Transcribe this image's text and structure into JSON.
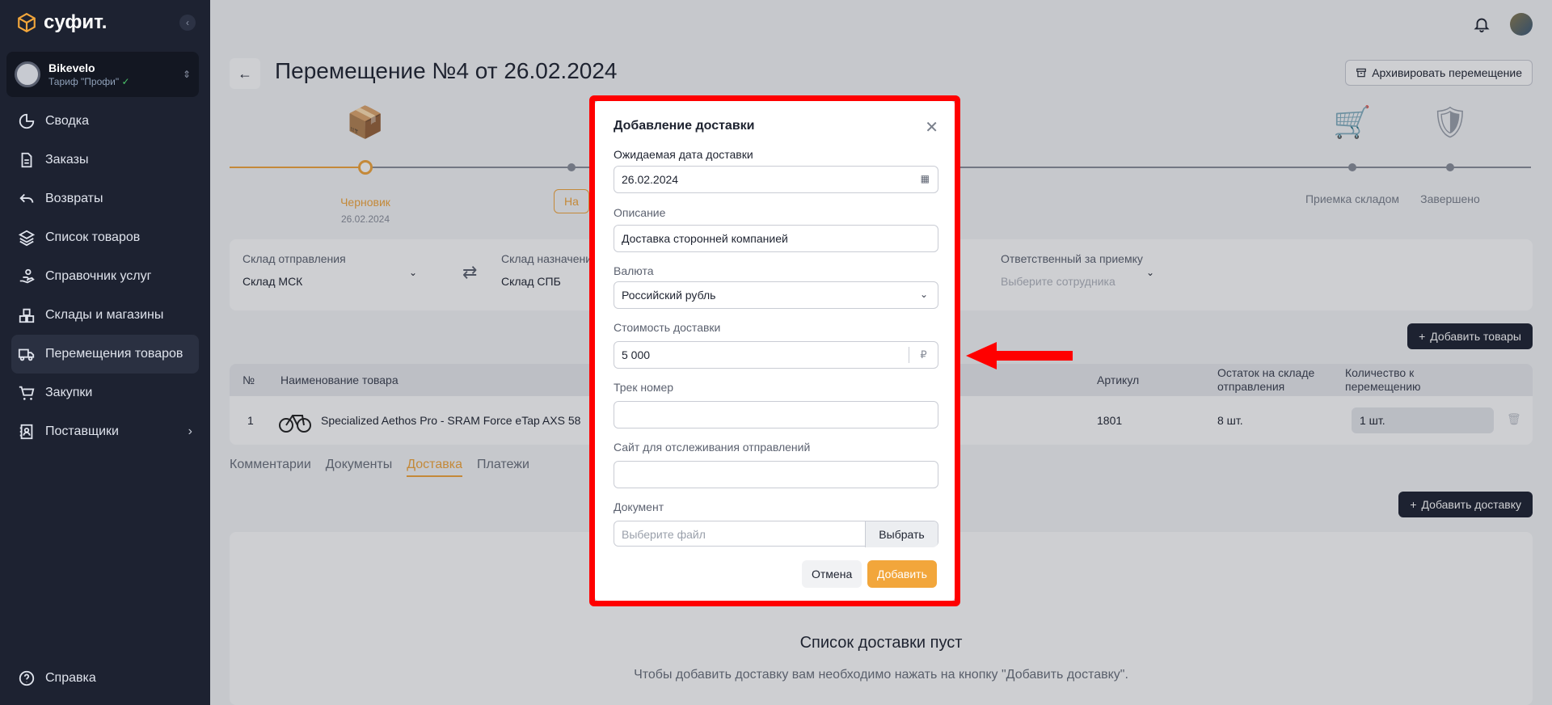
{
  "app": {
    "logo": "суфит.",
    "collapse": "‹"
  },
  "org": {
    "name": "Bikevelo",
    "plan": "Тариф \"Профи\"",
    "plan_check": "✓"
  },
  "nav": [
    {
      "label": "Сводка",
      "icon": "pie-chart-icon"
    },
    {
      "label": "Заказы",
      "icon": "document-icon"
    },
    {
      "label": "Возвраты",
      "icon": "return-icon"
    },
    {
      "label": "Список товаров",
      "icon": "layers-icon"
    },
    {
      "label": "Справочник услуг",
      "icon": "hand-service-icon"
    },
    {
      "label": "Склады и магазины",
      "icon": "boxes-icon"
    },
    {
      "label": "Перемещения товаров",
      "icon": "truck-icon",
      "active": true
    },
    {
      "label": "Закупки",
      "icon": "cart-icon"
    },
    {
      "label": "Поставщики",
      "icon": "contacts-icon",
      "chevron": "›"
    }
  ],
  "help": {
    "label": "Справка"
  },
  "header": {
    "back": "←",
    "title": "Перемещение №4 от 26.02.2024",
    "archive": "Архивировать перемещение"
  },
  "steps": [
    {
      "label": "Черновик",
      "date": "26.02.2024",
      "current": true
    },
    {
      "label": "На"
    },
    {
      "label": ""
    },
    {
      "label": ""
    },
    {
      "label": "Приемка складом"
    },
    {
      "label": "Завершено"
    }
  ],
  "warehouses": {
    "from_label": "Склад отправления",
    "from_value": "Склад МСК",
    "to_label": "Склад назначения",
    "to_value": "Склад СПБ",
    "resp_label": "Ответственный за приемку",
    "resp_placeholder": "Выберите сотрудника",
    "swap": "⇄",
    "caret": "⌄"
  },
  "add_goods": "Добавить товары",
  "table": {
    "headers": {
      "num": "№",
      "name": "Наименование товара",
      "sku": "Артикул",
      "stock": "Остаток на складе отправления",
      "qty": "Количество к перемещению"
    },
    "rows": [
      {
        "num": "1",
        "name": "Specialized Aethos Pro - SRAM Force eTap AXS 58",
        "sku": "1801",
        "stock": "8 шт.",
        "qty": "1 шт."
      }
    ]
  },
  "tabs": [
    "Комментарии",
    "Документы",
    "Доставка",
    "Платежи"
  ],
  "active_tab": "Доставка",
  "add_delivery": "Добавить доставку",
  "empty": {
    "title": "Список доставки пуст",
    "subtitle": "Чтобы добавить доставку вам необходимо нажать на кнопку \"Добавить доставку\"."
  },
  "modal": {
    "title": "Добавление доставки",
    "close": "✕",
    "date_label": "Ожидаемая дата доставки",
    "date_value": "26.02.2024",
    "desc_label": "Описание",
    "desc_value": "Доставка сторонней компанией",
    "currency_label": "Валюта",
    "currency_value": "Российский рубль",
    "cost_label": "Стоимость доставки",
    "cost_value": "5 000",
    "cost_suffix": "₽",
    "track_label": "Трек номер",
    "track_value": "",
    "site_label": "Сайт для отслеживания отправлений",
    "site_value": "",
    "doc_label": "Документ",
    "doc_placeholder": "Выберите файл",
    "doc_button": "Выбрать",
    "cancel": "Отмена",
    "add": "Добавить"
  },
  "colors": {
    "accent": "#f2a63b",
    "sidebar": "#1d2231",
    "highlight": "#ff0000"
  }
}
